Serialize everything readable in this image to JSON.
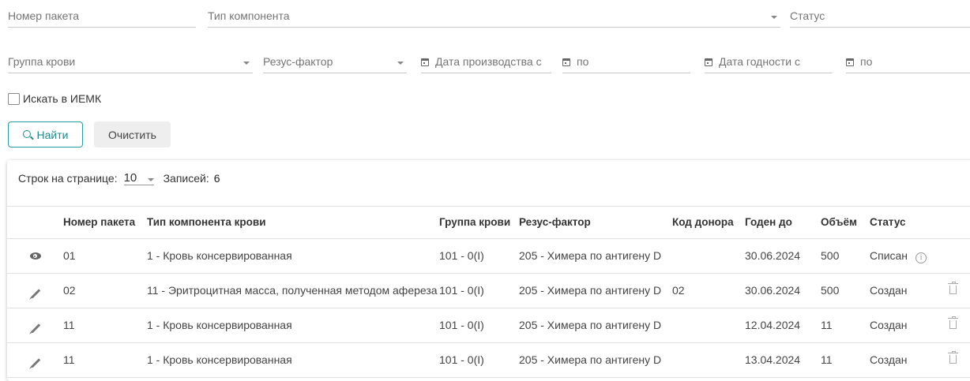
{
  "filters": {
    "package_number": "Номер пакета",
    "component_type": "Тип компонента",
    "status": "Статус",
    "blood_group": "Группа крови",
    "rh_factor": "Резус-фактор",
    "production_date_from": "Дата производства с",
    "production_date_to": "по",
    "expiry_date_from": "Дата годности с",
    "expiry_date_to": "по",
    "search_iemk": "Искать в ИЕМК"
  },
  "buttons": {
    "find": "Найти",
    "clear": "Очистить"
  },
  "pager": {
    "rows_label": "Строк на странице:",
    "rows_value": "10",
    "records_label": "Записей:",
    "records_value": "6"
  },
  "table": {
    "headers": {
      "package": "Номер пакета",
      "component": "Тип компонента крови",
      "group": "Группа крови",
      "rh": "Резус-фактор",
      "donor": "Код донора",
      "expiry": "Годен до",
      "volume": "Объём",
      "status": "Статус"
    },
    "rows": [
      {
        "action": "eye-icon",
        "package": "01",
        "component": "1 - Кровь консервированная",
        "group": "101 - 0(I)",
        "rh": "205 - Химера по антигену D",
        "donor": "",
        "expiry": "30.06.2024",
        "volume": "500",
        "status": "Списан",
        "extra": "info-icon"
      },
      {
        "action": "pencil-icon",
        "package": "02",
        "component": "11 - Эритроцитная масса, полученная методом афереза",
        "group": "101 - 0(I)",
        "rh": "205 - Химера по антигену D",
        "donor": "02",
        "expiry": "30.06.2024",
        "volume": "500",
        "status": "Создан",
        "extra": "trash-icon"
      },
      {
        "action": "pencil-icon",
        "package": "11",
        "component": "1 - Кровь консервированная",
        "group": "101 - 0(I)",
        "rh": "205 - Химера по антигену D",
        "donor": "",
        "expiry": "12.04.2024",
        "volume": "11",
        "status": "Создан",
        "extra": "trash-icon"
      },
      {
        "action": "pencil-icon",
        "package": "11",
        "component": "1 - Кровь консервированная",
        "group": "101 - 0(I)",
        "rh": "205 - Химера по антигену D",
        "donor": "",
        "expiry": "13.04.2024",
        "volume": "11",
        "status": "Создан",
        "extra": "trash-icon"
      }
    ]
  }
}
